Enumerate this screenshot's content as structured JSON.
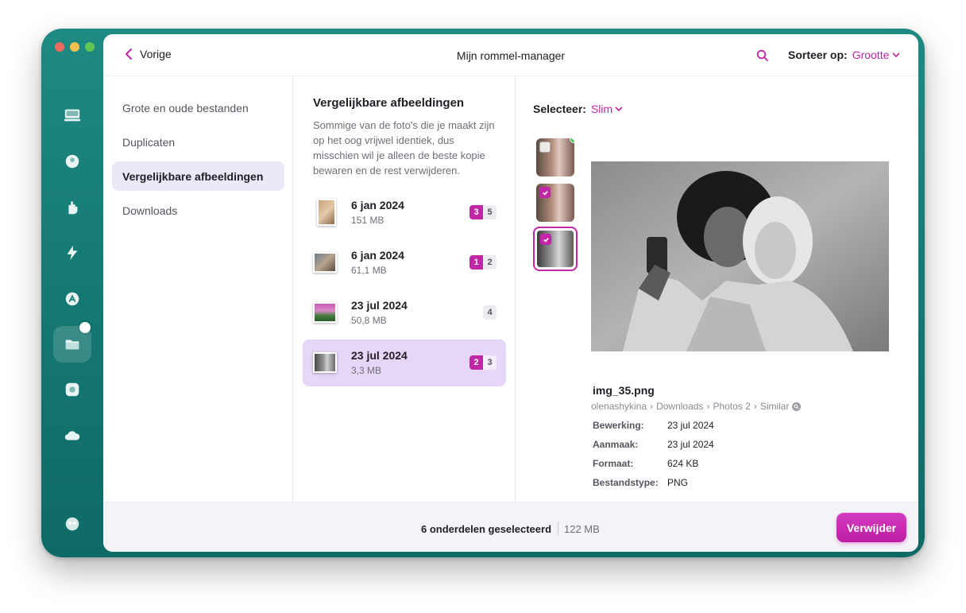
{
  "header": {
    "back_label": "Vorige",
    "title": "Mijn rommel-manager",
    "sort_label": "Sorteer op:",
    "sort_value": "Grootte"
  },
  "sidebar": {
    "items": [
      {
        "label": "Grote en oude bestanden",
        "active": false
      },
      {
        "label": "Duplicaten",
        "active": false
      },
      {
        "label": "Vergelijkbare afbeeldingen",
        "active": true
      },
      {
        "label": "Downloads",
        "active": false
      }
    ]
  },
  "groups_panel": {
    "title": "Vergelijkbare afbeeldingen",
    "description": "Sommige van de foto's die je maakt zijn op het oog vrijwel identiek, dus misschien wil je alleen de beste kopie bewaren en de rest verwijderen.",
    "groups": [
      {
        "date": "6 jan 2024",
        "size": "151 MB",
        "selected_count": "3",
        "total": "5",
        "selected": false
      },
      {
        "date": "6 jan 2024",
        "size": "61,1 MB",
        "selected_count": "1",
        "total": "2",
        "selected": false
      },
      {
        "date": "23 jul 2024",
        "size": "50,8 MB",
        "selected_count": "",
        "total": "4",
        "selected": false
      },
      {
        "date": "23 jul 2024",
        "size": "3,3 MB",
        "selected_count": "2",
        "total": "3",
        "selected": true
      }
    ]
  },
  "detail": {
    "select_label": "Selecteer:",
    "select_value": "Slim",
    "file_name": "img_35.png",
    "path": [
      "olenashykina",
      "Downloads",
      "Photos 2",
      "Similar"
    ],
    "meta": [
      {
        "key": "Bewerking:",
        "value": "23 jul 2024"
      },
      {
        "key": "Aanmaak:",
        "value": "23 jul 2024"
      },
      {
        "key": "Formaat:",
        "value": "624 KB"
      },
      {
        "key": "Bestandstype:",
        "value": "PNG"
      }
    ]
  },
  "footer": {
    "selected_text": "6 onderdelen geselecteerd",
    "total_size": "122 MB",
    "delete_label": "Verwijder"
  },
  "colors": {
    "accent": "#c026a6",
    "window_teal": "#167a74",
    "selected_row": "#e6d6f7"
  },
  "rail_icons": [
    "disk-icon",
    "cleanup-icon",
    "protection-icon",
    "speed-icon",
    "applications-icon",
    "files-icon",
    "space-lens-icon",
    "cloud-icon",
    "assistant-icon"
  ]
}
